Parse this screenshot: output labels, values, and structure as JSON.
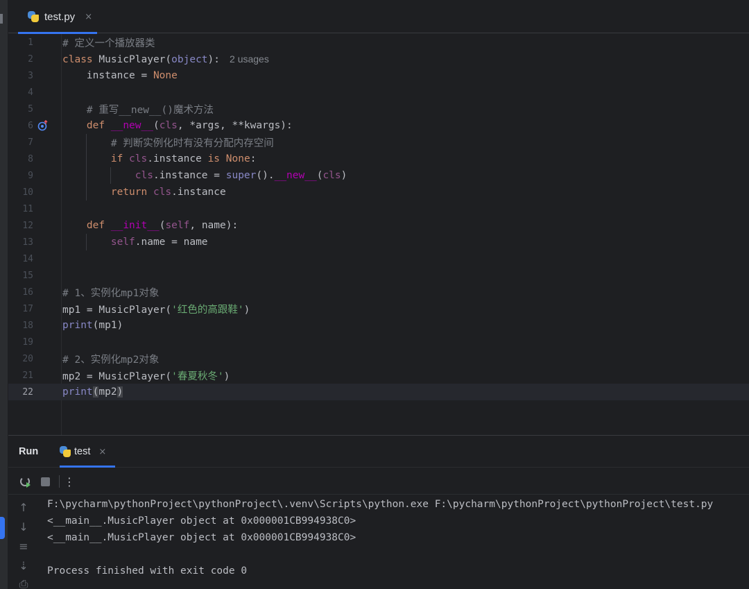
{
  "editor_tab": {
    "label": "test.py",
    "close": "×",
    "icon": "python-file-icon"
  },
  "code": {
    "lines": [
      "1",
      "2",
      "3",
      "4",
      "5",
      "6",
      "7",
      "8",
      "9",
      "10",
      "11",
      "12",
      "13",
      "14",
      "15",
      "16",
      "17",
      "18",
      "19",
      "20",
      "21",
      "22"
    ],
    "current_line": "22",
    "usages_hint": "2 usages",
    "text": {
      "l1": "# 定义一个播放器类",
      "l5": "# 重写__new__()魔术方法",
      "l7": "# 判断实例化时有没有分配内存空间",
      "l16": "# 1、实例化mp1对象",
      "l17_str": "'红色的高跟鞋'",
      "l20": "# 2、实例化mp2对象",
      "l21_str": "'春夏秋冬'"
    }
  },
  "run_panel": {
    "title": "Run",
    "tab_label": "test",
    "tab_close": "×",
    "output": [
      "F:\\pycharm\\pythonProject\\pythonProject\\.venv\\Scripts\\python.exe F:\\pycharm\\pythonProject\\pythonProject\\test.py",
      "<__main__.MusicPlayer object at 0x000001CB994938C0>",
      "<__main__.MusicPlayer object at 0x000001CB994938C0>",
      "",
      "Process finished with exit code 0"
    ]
  },
  "colors": {
    "background": "#1e1f22",
    "keyword": "#cf8e6d",
    "string": "#6aab73",
    "comment": "#7a7e85",
    "accent": "#3574f0"
  }
}
